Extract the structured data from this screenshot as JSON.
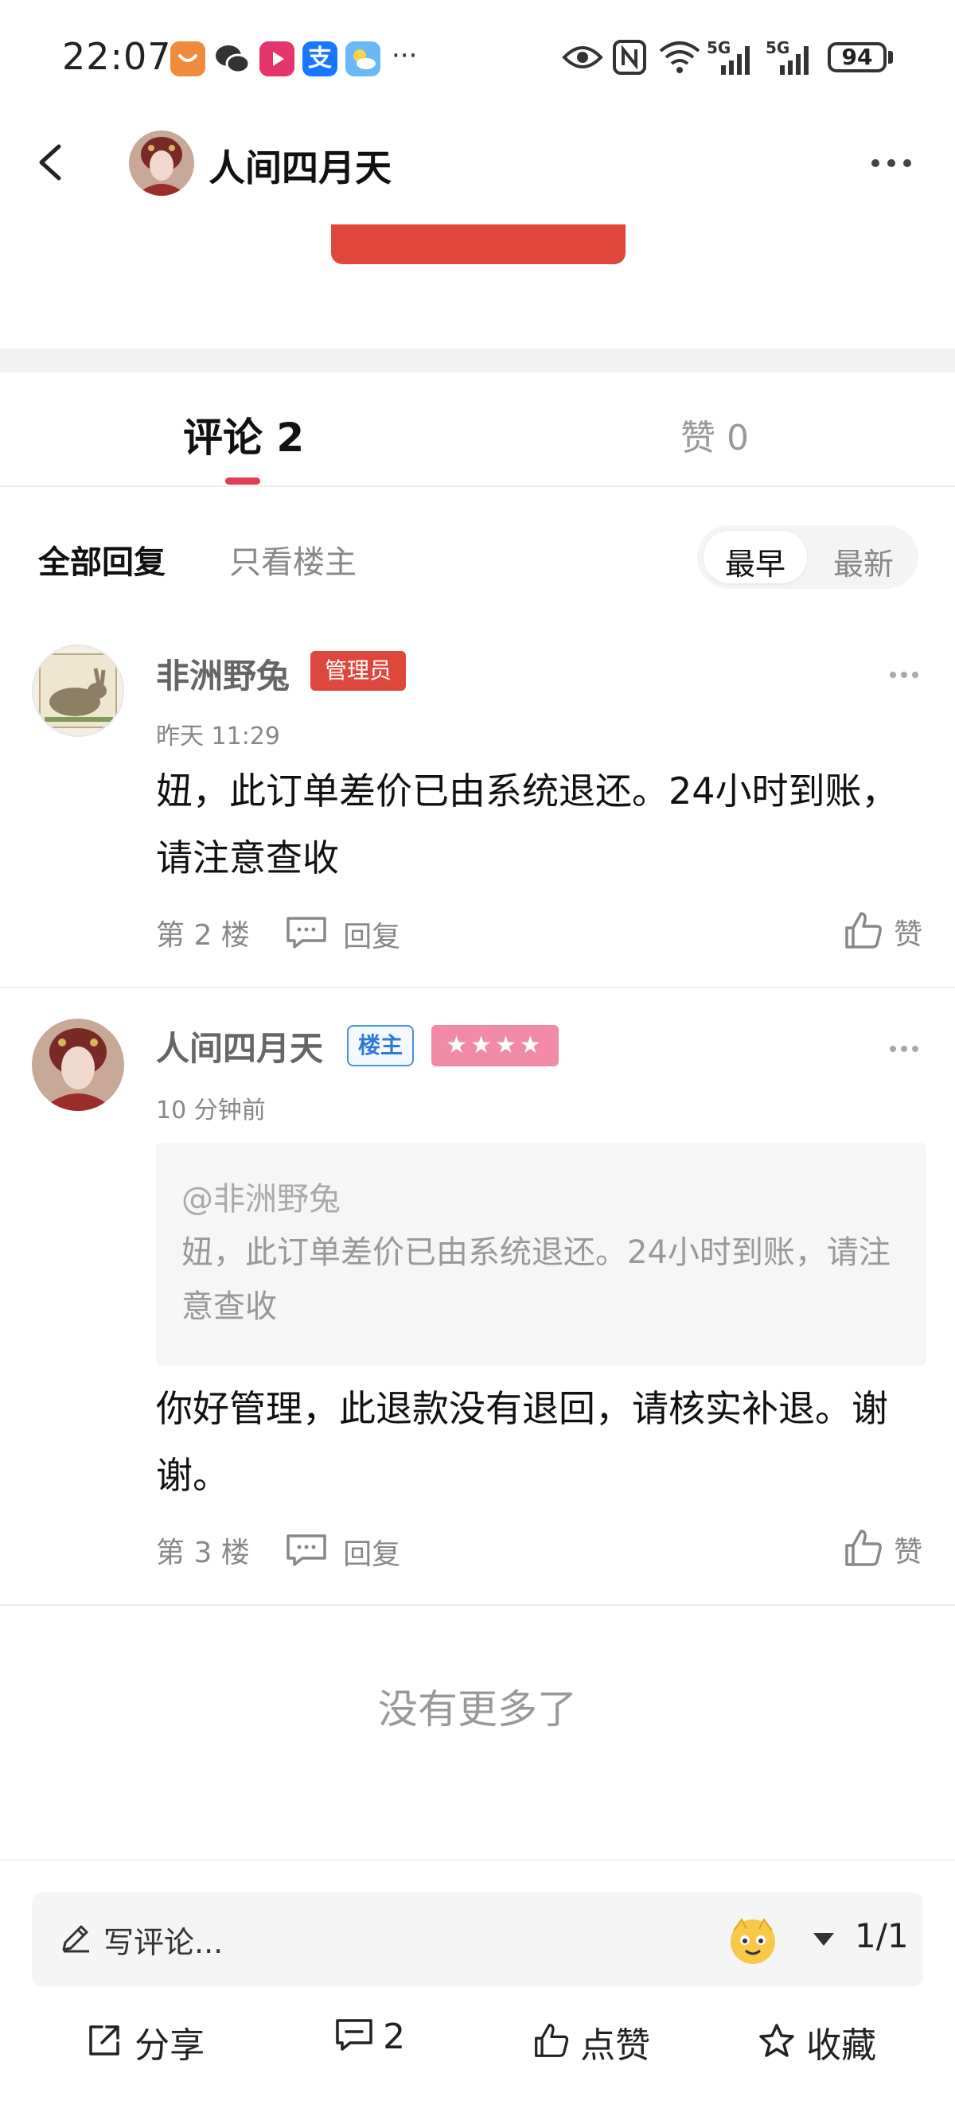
{
  "status_bar": {
    "time": "22:07",
    "more": "···",
    "battery": "94",
    "signal1": "5G",
    "signal2": "5G",
    "icons": [
      "taobao-app-icon",
      "wechat-icon",
      "video-app-icon",
      "alipay-icon",
      "weather-icon",
      "eye-icon",
      "nfc-icon",
      "wifi-icon",
      "signal-icon",
      "signal-icon",
      "battery-icon"
    ]
  },
  "header": {
    "title": "人间四月天"
  },
  "tabs": {
    "comments": "评论 2",
    "likes": "赞 0"
  },
  "filters": {
    "all": "全部回复",
    "owner_only": "只看楼主",
    "sort_earliest": "最早",
    "sort_latest": "最新"
  },
  "comments": [
    {
      "user": "非洲野兔",
      "badge": "管理员",
      "time": "昨天 11:29",
      "body": "妞，此订单差价已由系统退还。24小时到账，请注意查收",
      "floor": "第 2 楼",
      "reply": "回复",
      "like": "赞"
    },
    {
      "user": "人间四月天",
      "badge": "楼主",
      "stars": "★★★★",
      "time": "10 分钟前",
      "quote_user": "@非洲野兔",
      "quote_text": "妞，此订单差价已由系统退还。24小时到账，请注意查收",
      "body": "你好管理，此退款没有退回，请核实补退。谢谢。",
      "floor": "第 3 楼",
      "reply": "回复",
      "like": "赞"
    }
  ],
  "end_text": "没有更多了",
  "bottom_bar": {
    "input_placeholder": "写评论...",
    "page": "1/1",
    "share": "分享",
    "comment_count": "2",
    "like": "点赞",
    "favorite": "收藏"
  },
  "colors": {
    "accent_red": "#e0473c",
    "tab_underline": "#e33d55",
    "owner_blue": "#2f7ad8",
    "stars_pink": "#f08aa6"
  }
}
